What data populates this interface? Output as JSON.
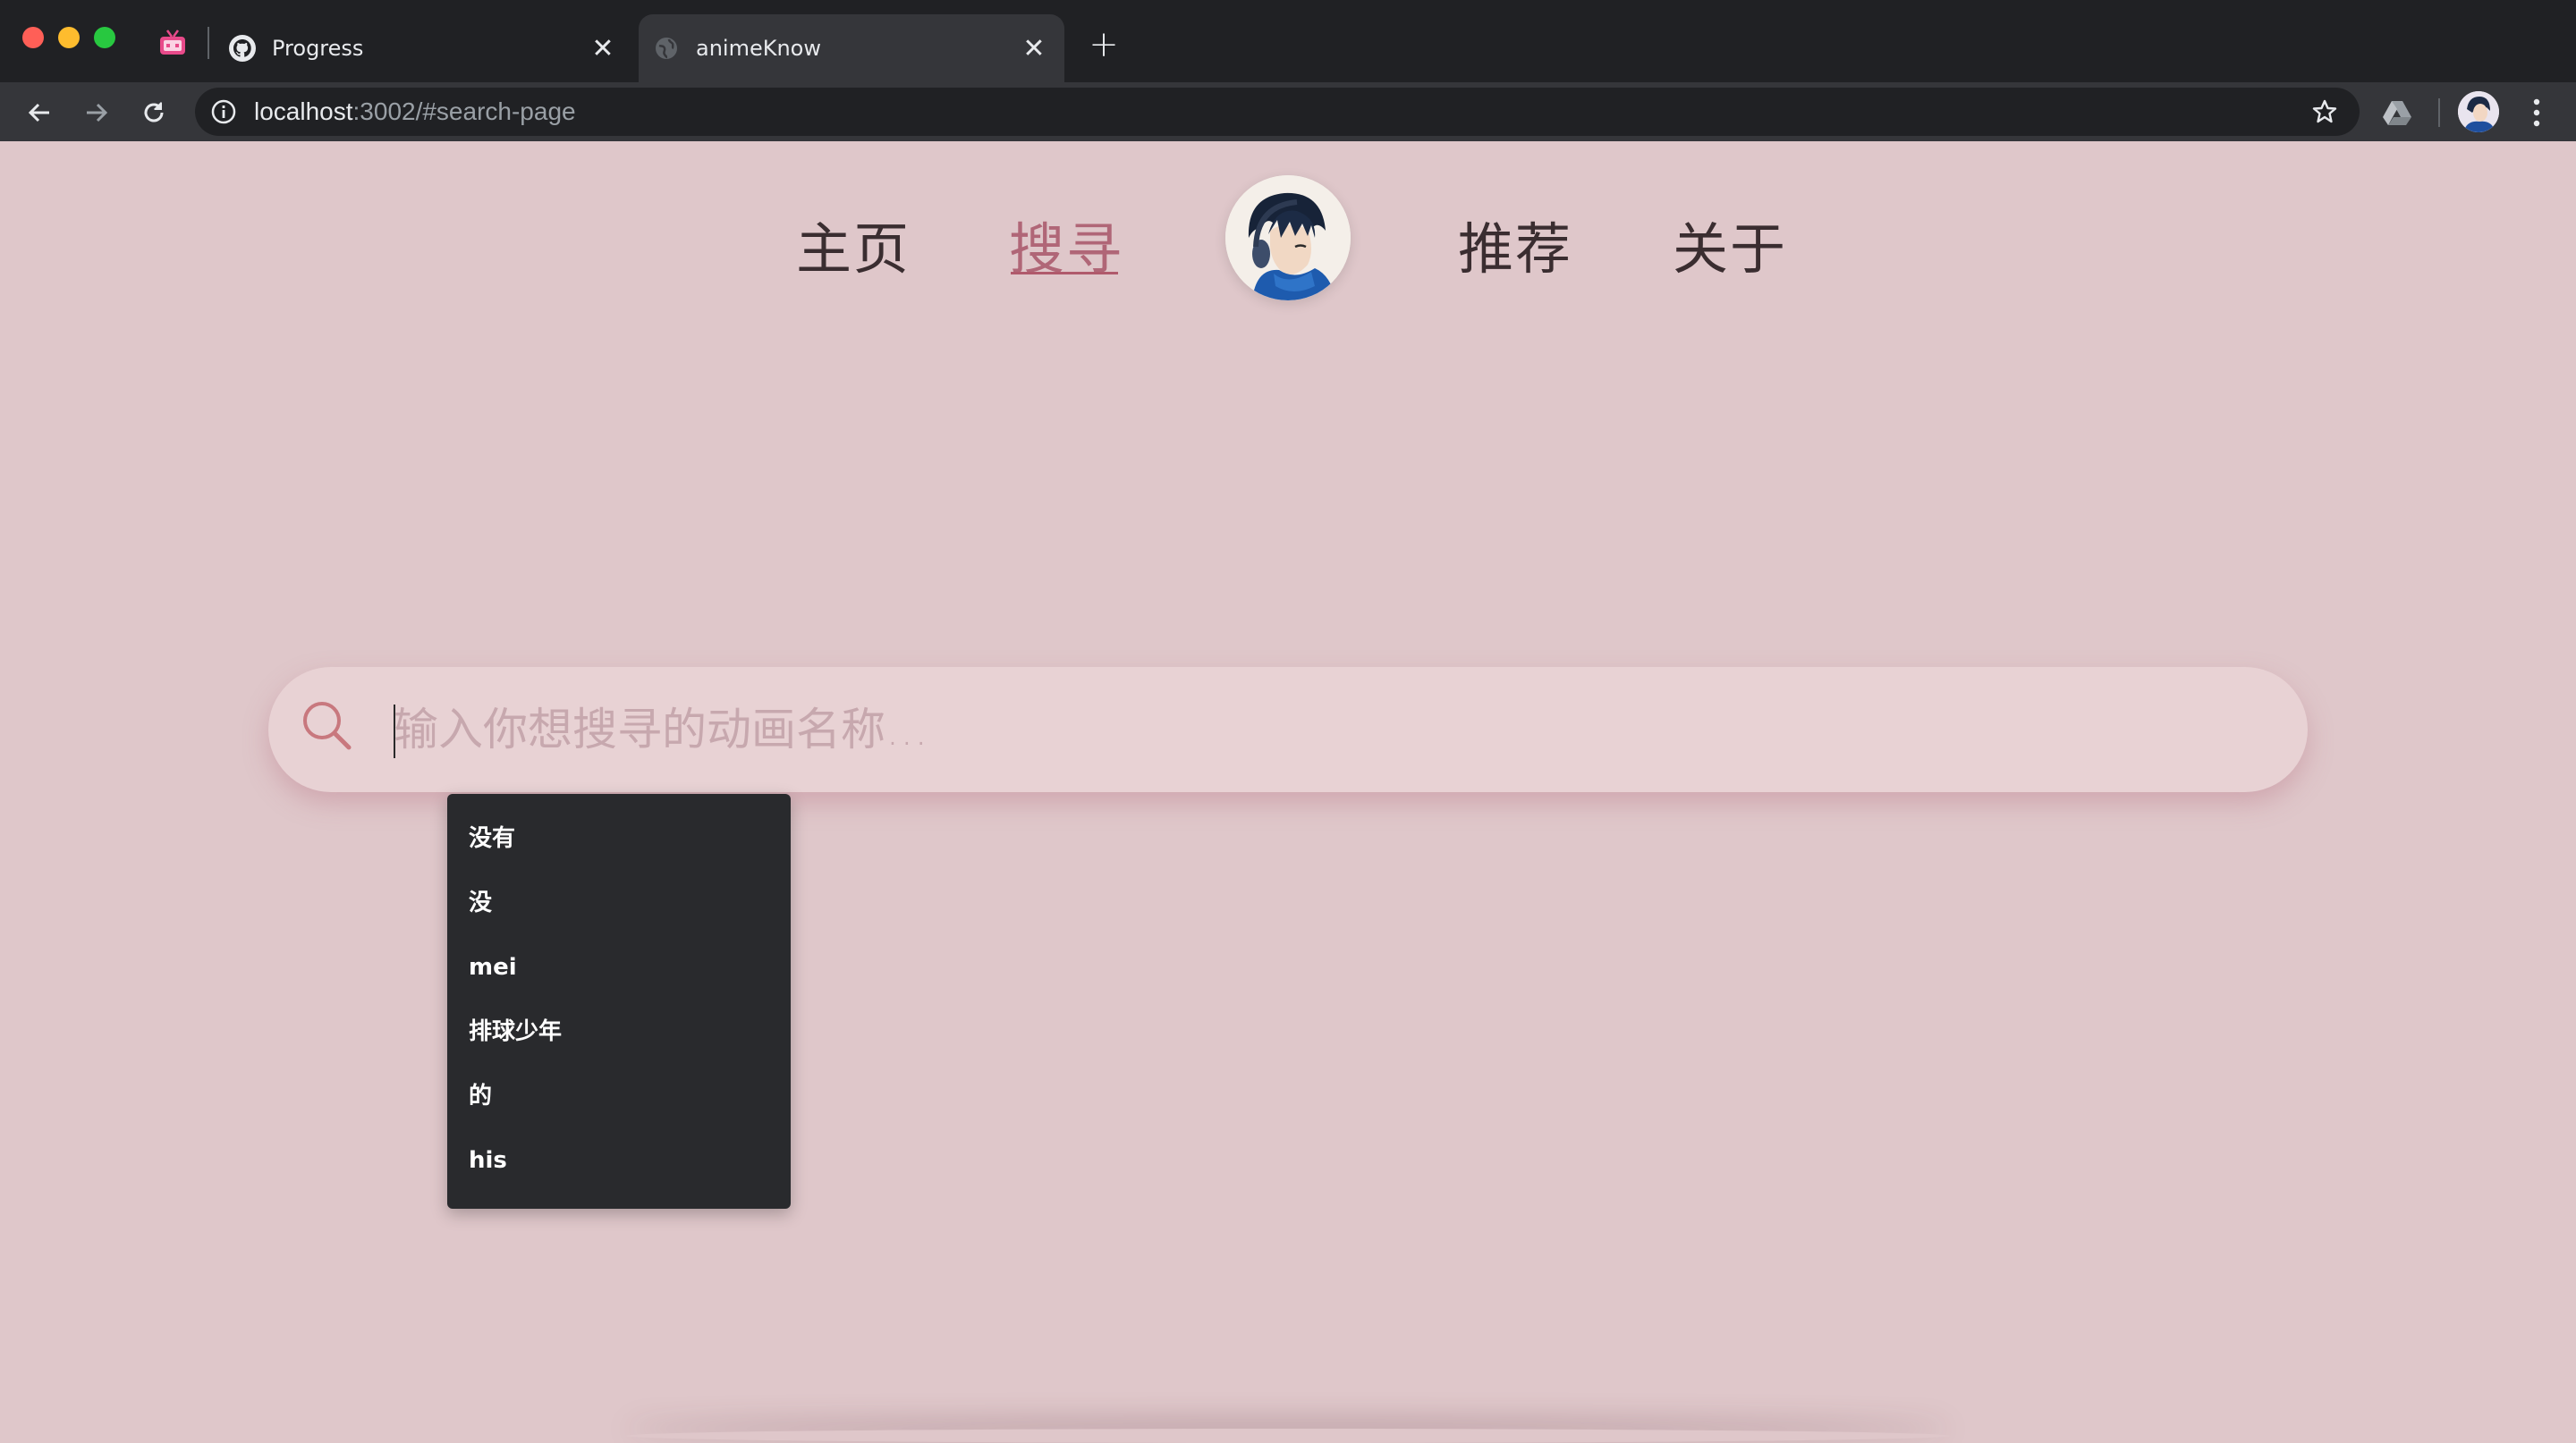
{
  "browser": {
    "tabs": [
      {
        "title": "Progress",
        "favicon": "github-icon",
        "active": false
      },
      {
        "title": "animeKnow",
        "favicon": "globe-icon",
        "active": true
      }
    ],
    "url_host": "localhost",
    "url_rest": ":3002/#search-page"
  },
  "site_nav": {
    "home": "主页",
    "search": "搜寻",
    "recommend": "推荐",
    "about": "关于",
    "active": "search"
  },
  "search": {
    "placeholder": "输入你想搜寻的动画名称...",
    "value": ""
  },
  "autocomplete": {
    "items": [
      "没有",
      "没",
      "mei",
      "排球少年",
      "的",
      "his"
    ]
  },
  "colors": {
    "page_bg": "#dfc7ca",
    "accent": "#b06677",
    "search_bg": "#e8d2d4",
    "dropdown_bg": "#292a2d"
  }
}
